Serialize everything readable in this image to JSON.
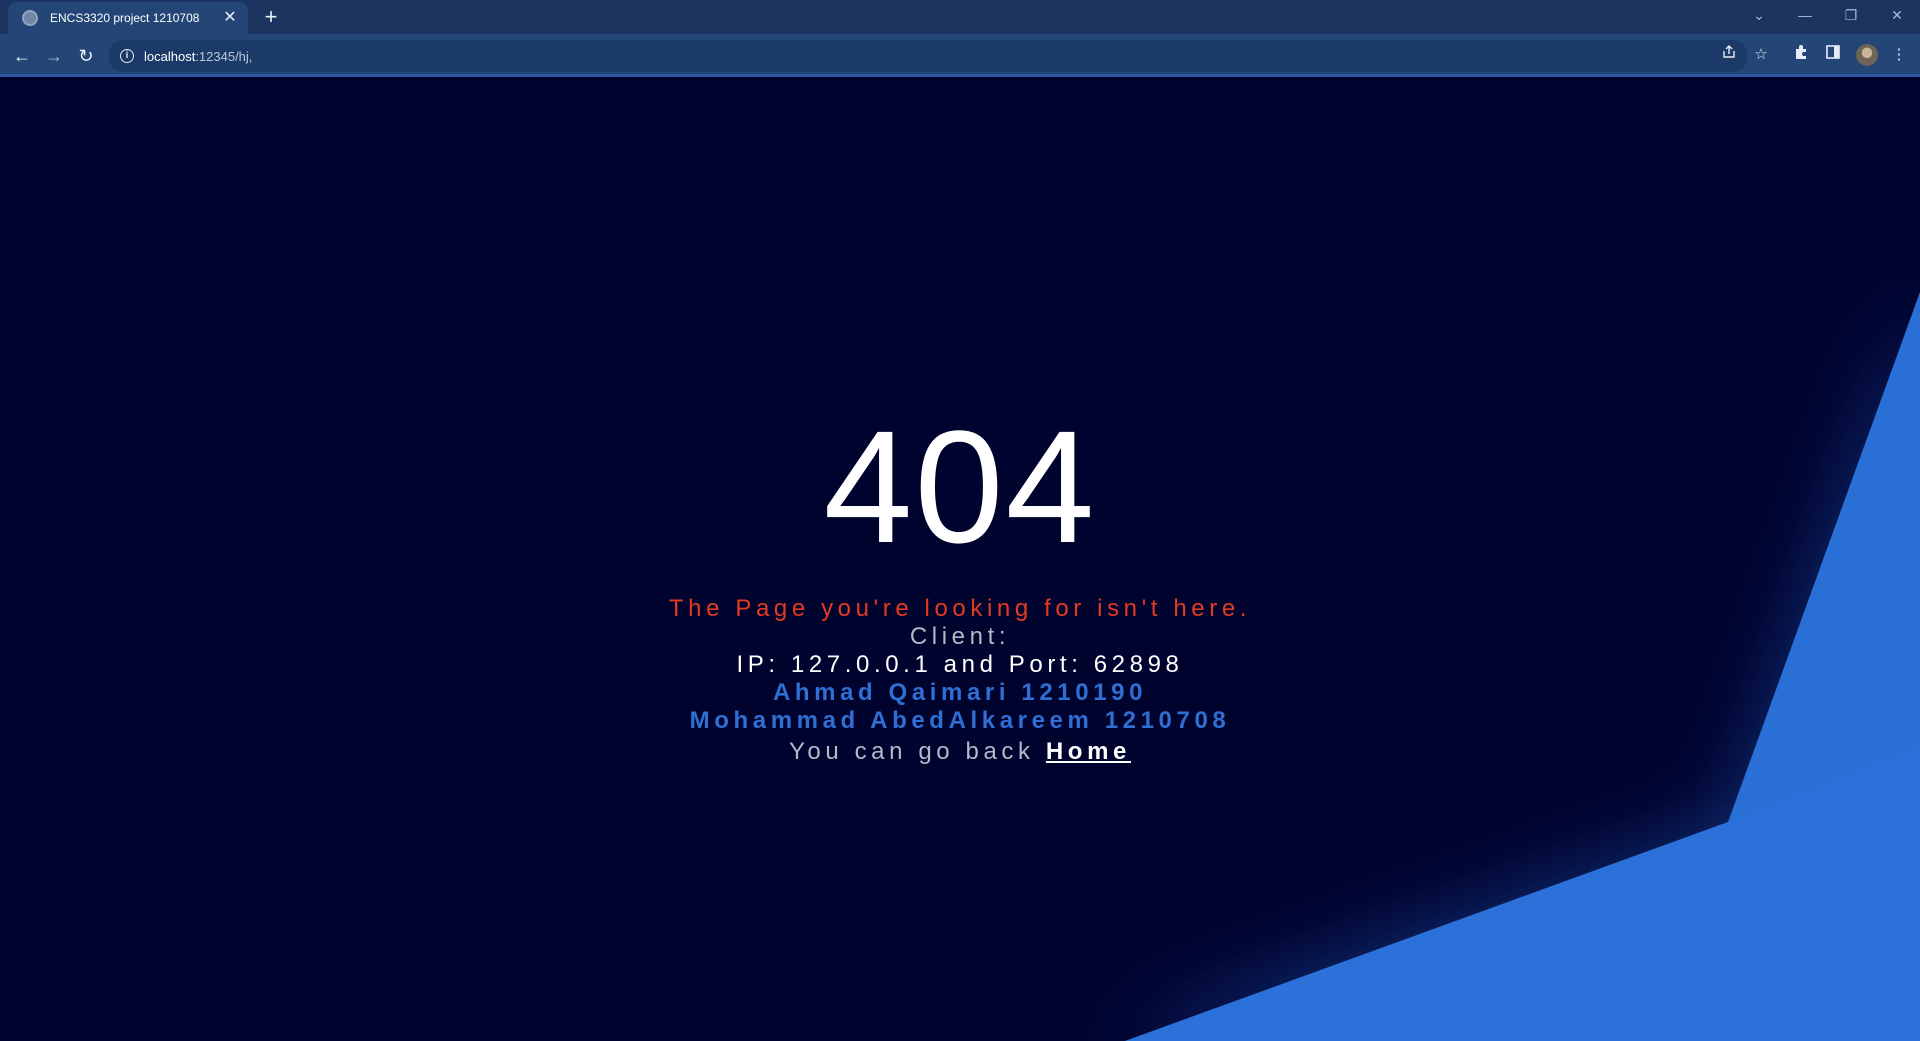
{
  "browser": {
    "tab_title": "ENCS3320 project 1210708",
    "tab_close": "✕",
    "new_tab": "+",
    "url_host": "localhost",
    "url_path": ":12345/hj,",
    "window_controls": {
      "dropdown": "⌄",
      "minimize": "—",
      "restore": "❐",
      "close": "✕"
    },
    "nav": {
      "back": "←",
      "forward": "→",
      "reload": "↻"
    },
    "icons": [
      "share-icon",
      "star-icon",
      "extensions-icon",
      "side-panel-icon",
      "profile-avatar",
      "more-icon"
    ]
  },
  "page": {
    "code": "404",
    "message": "The Page you're looking for isn't here.",
    "client_label": "Client:",
    "ip_line": "IP: 127.0.0.1 and Port: 62898",
    "authors": [
      "Ahmad Qaimari 1210190",
      "Mohammad AbedAlkareem 1210708"
    ],
    "back_text": "You can go back ",
    "home_link": "Home"
  },
  "colors": {
    "background": "#01032f",
    "accent_blue": "#2a6fd6",
    "error_red": "#e33a22",
    "author_blue": "#2f6ed3",
    "chrome": "#244677"
  }
}
